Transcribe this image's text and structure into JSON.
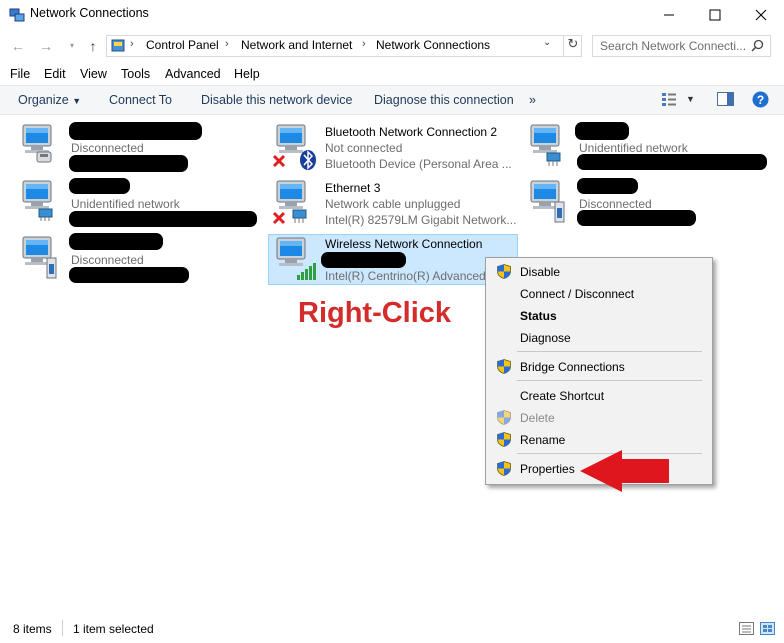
{
  "window": {
    "title": "Network Connections"
  },
  "address": {
    "breadcrumbs": [
      "Control Panel",
      "Network and Internet",
      "Network Connections"
    ],
    "search_placeholder": "Search Network Connecti..."
  },
  "menubar": [
    "File",
    "Edit",
    "View",
    "Tools",
    "Advanced",
    "Help"
  ],
  "commandbar": {
    "organize": "Organize",
    "connect_to": "Connect To",
    "disable": "Disable this network device",
    "diagnose": "Diagnose this connection",
    "more": "»"
  },
  "items": [
    {
      "name": "",
      "status": "Disconnected",
      "device": ""
    },
    {
      "name": "",
      "status": "Unidentified network",
      "device": ""
    },
    {
      "name": "",
      "status": "Disconnected",
      "device": ""
    },
    {
      "name": "Bluetooth Network Connection 2",
      "status": "Not connected",
      "device": "Bluetooth Device (Personal Area ..."
    },
    {
      "name": "Ethernet 3",
      "status": "Network cable unplugged",
      "device": "Intel(R) 82579LM Gigabit Network..."
    },
    {
      "name": "Wireless Network Connection",
      "status": "",
      "device": "Intel(R) Centrino(R) Advanced-"
    },
    {
      "name": "",
      "status": "Unidentified network",
      "device": ""
    },
    {
      "name": "",
      "status": "Disconnected",
      "device": ""
    }
  ],
  "annotation": {
    "text": "Right-Click",
    "color": "#d42b2b"
  },
  "context_menu": {
    "disable": "Disable",
    "connect": "Connect / Disconnect",
    "status": "Status",
    "diagnose": "Diagnose",
    "bridge": "Bridge Connections",
    "shortcut": "Create Shortcut",
    "delete": "Delete",
    "rename": "Rename",
    "properties": "Properties"
  },
  "statusbar": {
    "count": "8 items",
    "selection": "1 item selected"
  },
  "colors": {
    "accent": "#1e395b",
    "selection": "#cce8ff",
    "arrow": "#e0161e"
  }
}
